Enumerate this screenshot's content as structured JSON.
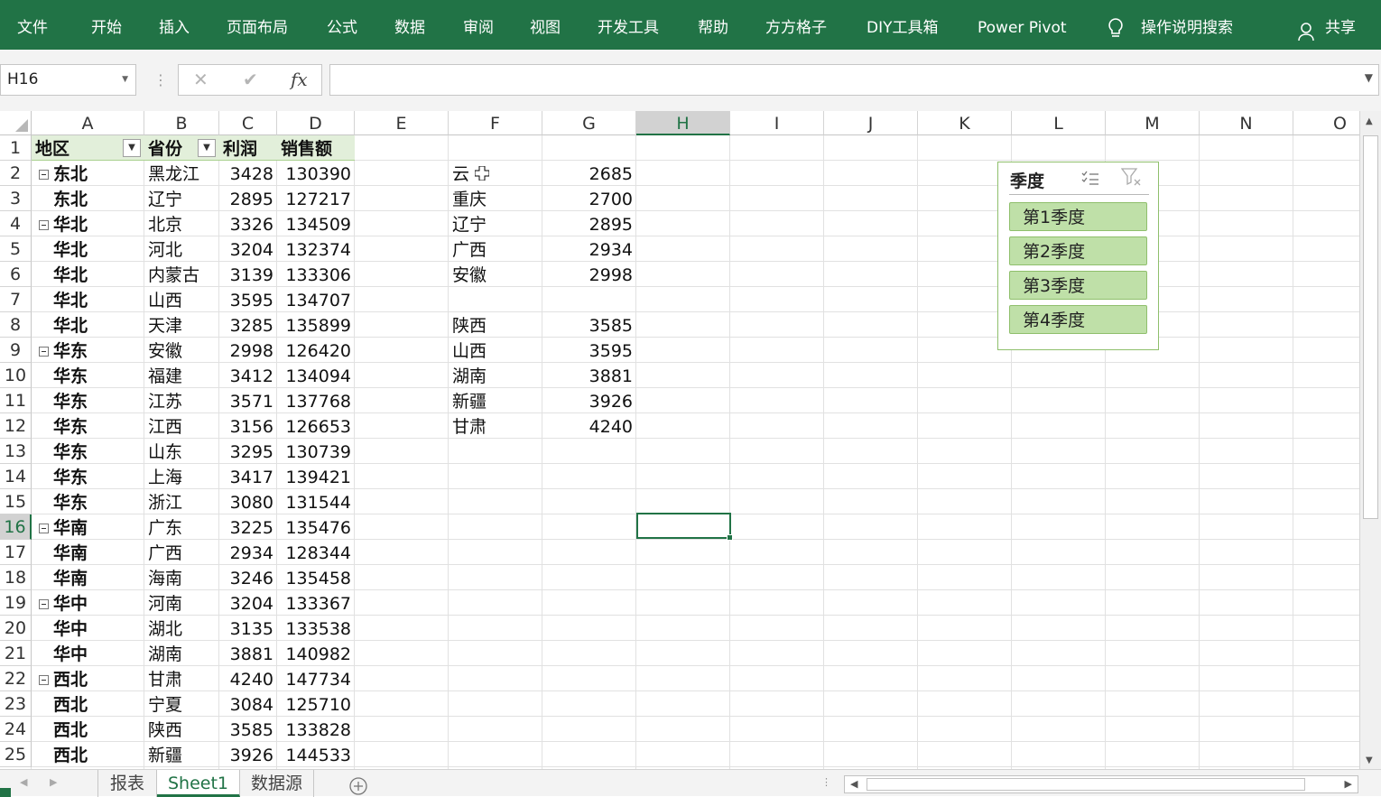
{
  "ribbon": {
    "tabs": [
      "文件",
      "开始",
      "插入",
      "页面布局",
      "公式",
      "数据",
      "审阅",
      "视图",
      "开发工具",
      "帮助",
      "方方格子",
      "DIY工具箱",
      "Power Pivot",
      "操作说明搜索"
    ],
    "share": "共享"
  },
  "formula_bar": {
    "name_box": "H16",
    "formula": "",
    "fx": "fx"
  },
  "columns": [
    "A",
    "B",
    "C",
    "D",
    "E",
    "F",
    "G",
    "H",
    "I",
    "J",
    "K",
    "L",
    "M",
    "N",
    "O"
  ],
  "selected_column": "H",
  "selected_row": 16,
  "rows": [
    "1",
    "2",
    "3",
    "4",
    "5",
    "6",
    "7",
    "8",
    "9",
    "10",
    "11",
    "12",
    "13",
    "14",
    "15",
    "16",
    "17",
    "18",
    "19",
    "20",
    "21",
    "22",
    "23",
    "24",
    "25"
  ],
  "pivot": {
    "headers": [
      "地区",
      "省份",
      "利润",
      "销售额"
    ],
    "rows": [
      {
        "region": "东北",
        "province": "黑龙江",
        "profit": "3428",
        "sales": "130390",
        "group": true
      },
      {
        "region": "东北",
        "province": "辽宁",
        "profit": "2895",
        "sales": "127217",
        "group": false
      },
      {
        "region": "华北",
        "province": "北京",
        "profit": "3326",
        "sales": "134509",
        "group": true
      },
      {
        "region": "华北",
        "province": "河北",
        "profit": "3204",
        "sales": "132374",
        "group": false
      },
      {
        "region": "华北",
        "province": "内蒙古",
        "profit": "3139",
        "sales": "133306",
        "group": false
      },
      {
        "region": "华北",
        "province": "山西",
        "profit": "3595",
        "sales": "134707",
        "group": false
      },
      {
        "region": "华北",
        "province": "天津",
        "profit": "3285",
        "sales": "135899",
        "group": false
      },
      {
        "region": "华东",
        "province": "安徽",
        "profit": "2998",
        "sales": "126420",
        "group": true
      },
      {
        "region": "华东",
        "province": "福建",
        "profit": "3412",
        "sales": "134094",
        "group": false
      },
      {
        "region": "华东",
        "province": "江苏",
        "profit": "3571",
        "sales": "137768",
        "group": false
      },
      {
        "region": "华东",
        "province": "江西",
        "profit": "3156",
        "sales": "126653",
        "group": false
      },
      {
        "region": "华东",
        "province": "山东",
        "profit": "3295",
        "sales": "130739",
        "group": false
      },
      {
        "region": "华东",
        "province": "上海",
        "profit": "3417",
        "sales": "139421",
        "group": false
      },
      {
        "region": "华东",
        "province": "浙江",
        "profit": "3080",
        "sales": "131544",
        "group": false
      },
      {
        "region": "华南",
        "province": "广东",
        "profit": "3225",
        "sales": "135476",
        "group": true
      },
      {
        "region": "华南",
        "province": "广西",
        "profit": "2934",
        "sales": "128344",
        "group": false
      },
      {
        "region": "华南",
        "province": "海南",
        "profit": "3246",
        "sales": "135458",
        "group": false
      },
      {
        "region": "华中",
        "province": "河南",
        "profit": "3204",
        "sales": "133367",
        "group": true
      },
      {
        "region": "华中",
        "province": "湖北",
        "profit": "3135",
        "sales": "133538",
        "group": false
      },
      {
        "region": "华中",
        "province": "湖南",
        "profit": "3881",
        "sales": "140982",
        "group": false
      },
      {
        "region": "西北",
        "province": "甘肃",
        "profit": "4240",
        "sales": "147734",
        "group": true
      },
      {
        "region": "西北",
        "province": "宁夏",
        "profit": "3084",
        "sales": "125710",
        "group": false
      },
      {
        "region": "西北",
        "province": "陕西",
        "profit": "3585",
        "sales": "133828",
        "group": false
      },
      {
        "region": "西北",
        "province": "新疆",
        "profit": "3926",
        "sales": "144533",
        "group": false
      }
    ]
  },
  "side_list": [
    {
      "row": 2,
      "name": "云",
      "value": "2685"
    },
    {
      "row": 3,
      "name": "重庆",
      "value": "2700"
    },
    {
      "row": 4,
      "name": "辽宁",
      "value": "2895"
    },
    {
      "row": 5,
      "name": "广西",
      "value": "2934"
    },
    {
      "row": 6,
      "name": "安徽",
      "value": "2998"
    },
    {
      "row": 8,
      "name": "陕西",
      "value": "3585"
    },
    {
      "row": 9,
      "name": "山西",
      "value": "3595"
    },
    {
      "row": 10,
      "name": "湖南",
      "value": "3881"
    },
    {
      "row": 11,
      "name": "新疆",
      "value": "3926"
    },
    {
      "row": 12,
      "name": "甘肃",
      "value": "4240"
    }
  ],
  "slicer": {
    "title": "季度",
    "items": [
      "第1季度",
      "第2季度",
      "第3季度",
      "第4季度"
    ]
  },
  "sheet_tabs": [
    "报表",
    "Sheet1",
    "数据源"
  ],
  "active_sheet": "Sheet1"
}
